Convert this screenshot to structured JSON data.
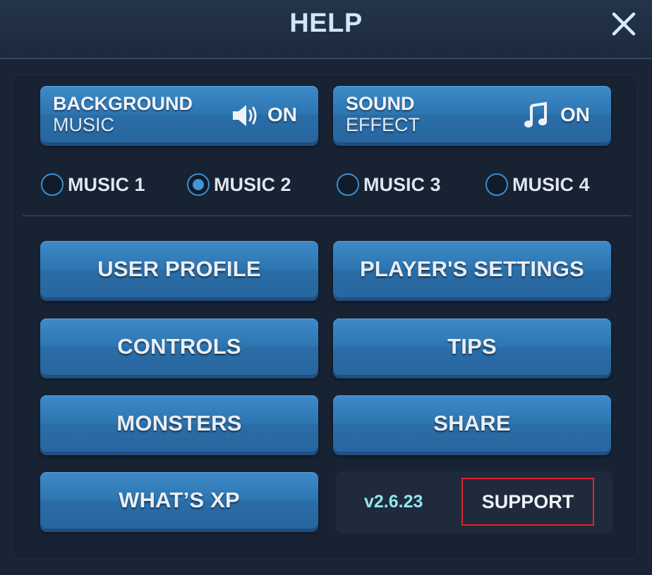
{
  "header": {
    "title": "HELP",
    "close_icon": "close-icon"
  },
  "audio": {
    "background_music": {
      "line1": "BACKGROUND",
      "line2": "MUSIC",
      "state": "ON",
      "icon": "speaker-icon"
    },
    "sound_effect": {
      "line1": "SOUND",
      "line2": "EFFECT",
      "state": "ON",
      "icon": "music-note-icon"
    }
  },
  "music_options": {
    "items": [
      {
        "label": "MUSIC 1",
        "selected": false
      },
      {
        "label": "MUSIC 2",
        "selected": true
      },
      {
        "label": "MUSIC 3",
        "selected": false
      },
      {
        "label": "MUSIC 4",
        "selected": false
      }
    ]
  },
  "menu": {
    "user_profile": "USER PROFILE",
    "players_settings": "PLAYER'S SETTINGS",
    "controls": "CONTROLS",
    "tips": "TIPS",
    "monsters": "MONSTERS",
    "share": "SHARE",
    "whats_xp": "WHAT’S XP"
  },
  "footer": {
    "version": "v2.6.23",
    "support": "SUPPORT"
  },
  "colors": {
    "background": "#1a2434",
    "button_blue": "#2d75b1",
    "title_text": "#cfe6fb",
    "version_text": "#8fe8ef",
    "highlight_border": "#e3252d"
  }
}
